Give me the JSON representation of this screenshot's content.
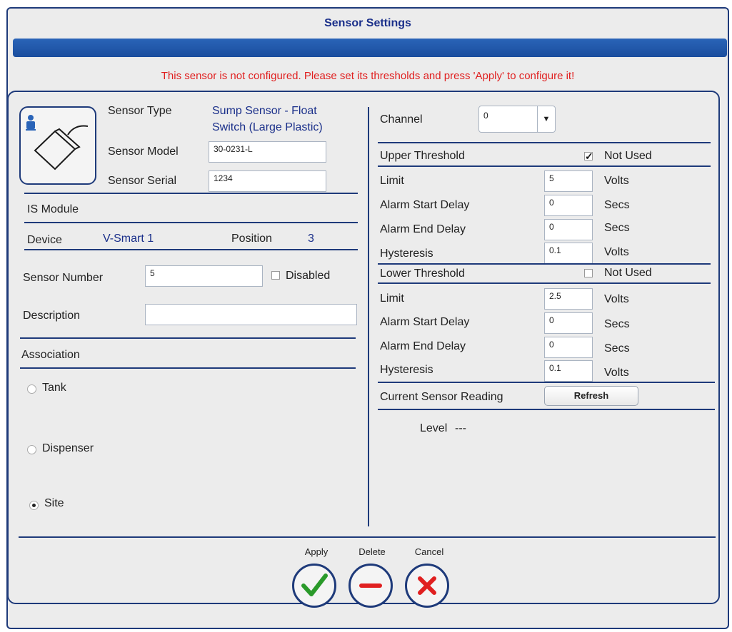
{
  "window": {
    "title": "Sensor Settings",
    "warning": "This sensor is not configured. Please set its thresholds and press 'Apply' to configure it!"
  },
  "sensor": {
    "icon": "float-switch-sensor-icon",
    "type_label": "Sensor Type",
    "type_value_line1": "Sump Sensor - Float",
    "type_value_line2": "Switch (Large Plastic)",
    "model_label": "Sensor Model",
    "model_value": "30-0231-L",
    "serial_label": "Sensor Serial",
    "serial_value": "1234"
  },
  "is_module": {
    "heading": "IS Module",
    "device_label": "Device",
    "device_value": "V-Smart 1",
    "position_label": "Position",
    "position_value": "3"
  },
  "sensor_number": {
    "label": "Sensor Number",
    "value": "5",
    "disabled_label": "Disabled",
    "disabled_checked": false
  },
  "description": {
    "label": "Description",
    "value": ""
  },
  "association": {
    "heading": "Association",
    "options": [
      {
        "label": "Tank",
        "checked": false
      },
      {
        "label": "Dispenser",
        "checked": false
      },
      {
        "label": "Site",
        "checked": true
      }
    ]
  },
  "channel": {
    "label": "Channel",
    "value": "0"
  },
  "upper_threshold": {
    "heading": "Upper Threshold",
    "not_used_label": "Not Used",
    "not_used_checked": true,
    "limit_label": "Limit",
    "limit_value": "5",
    "limit_unit": "Volts",
    "start_delay_label": "Alarm Start Delay",
    "start_delay_value": "0",
    "start_delay_unit": "Secs",
    "end_delay_label": "Alarm End Delay",
    "end_delay_value": "0",
    "end_delay_unit": "Secs",
    "hysteresis_label": "Hysteresis",
    "hysteresis_value": "0.1",
    "hysteresis_unit": "Volts"
  },
  "lower_threshold": {
    "heading": "Lower Threshold",
    "not_used_label": "Not Used",
    "not_used_checked": false,
    "limit_label": "Limit",
    "limit_value": "2.5",
    "limit_unit": "Volts",
    "start_delay_label": "Alarm Start Delay",
    "start_delay_value": "0",
    "start_delay_unit": "Secs",
    "end_delay_label": "Alarm End Delay",
    "end_delay_value": "0",
    "end_delay_unit": "Secs",
    "hysteresis_label": "Hysteresis",
    "hysteresis_value": "0.1",
    "hysteresis_unit": "Volts"
  },
  "reading": {
    "label": "Current Sensor Reading",
    "refresh_label": "Refresh",
    "level_label": "Level",
    "level_value": "---"
  },
  "actions": {
    "apply_label": "Apply",
    "delete_label": "Delete",
    "cancel_label": "Cancel"
  },
  "colors": {
    "accent": "#1e3a7a",
    "link_text": "#1a2f8a",
    "warning": "#e02020",
    "apply_check": "#2a9a2a",
    "delete_minus": "#e02020",
    "cancel_x": "#e02020"
  }
}
